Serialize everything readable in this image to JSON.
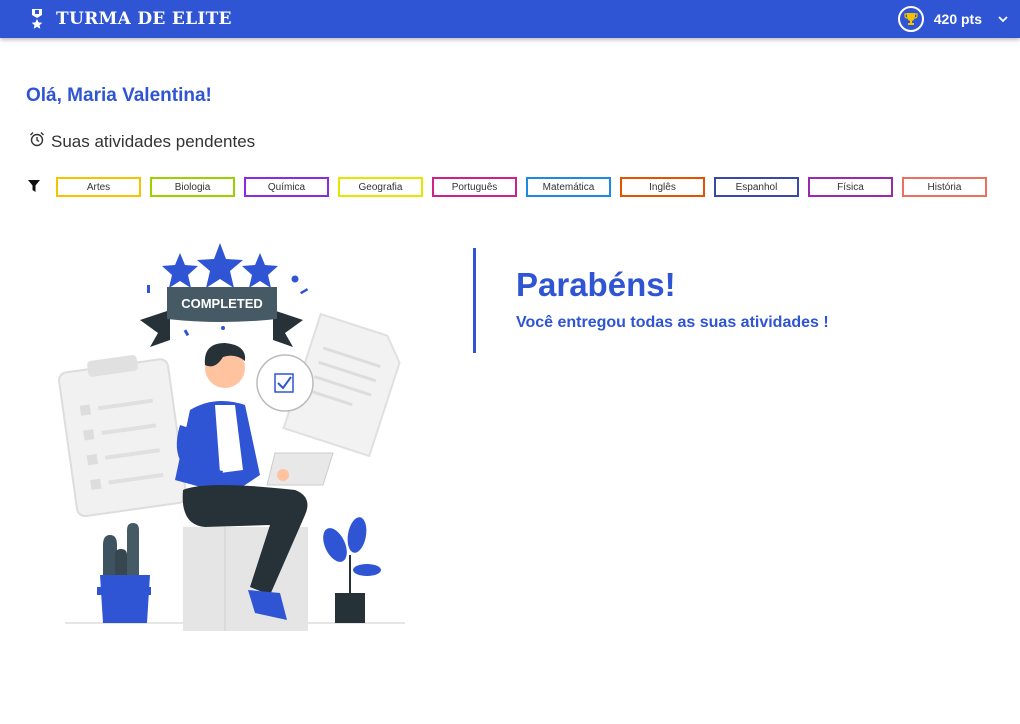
{
  "header": {
    "title": "TURMA DE ELITE",
    "points": "420 pts",
    "brand_color": "#2f55d4"
  },
  "greeting": "Olá, Maria Valentina!",
  "pending_title": "Suas atividades pendentes",
  "filters": [
    {
      "label": "Artes",
      "color": "#f5c400"
    },
    {
      "label": "Biologia",
      "color": "#9bd100"
    },
    {
      "label": "Química",
      "color": "#8a2be2"
    },
    {
      "label": "Geografia",
      "color": "#e5e600"
    },
    {
      "label": "Português",
      "color": "#d0208a"
    },
    {
      "label": "Matemática",
      "color": "#1e88e5"
    },
    {
      "label": "Inglês",
      "color": "#e65100"
    },
    {
      "label": "Espanhol",
      "color": "#3949ab"
    },
    {
      "label": "Física",
      "color": "#9c27b0"
    },
    {
      "label": "História",
      "color": "#ef6f5e"
    }
  ],
  "illustration": {
    "banner_text": "COMPLETED"
  },
  "congrats": {
    "title": "Parabéns!",
    "subtitle": "Você entregou todas as suas atividades !"
  }
}
